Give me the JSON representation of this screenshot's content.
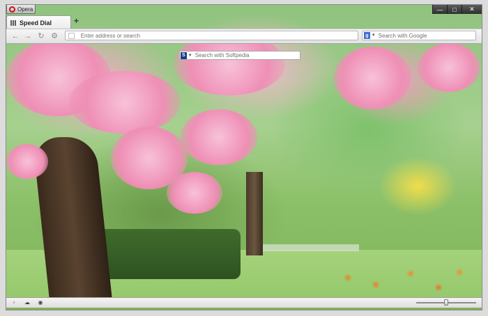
{
  "titlebar": {
    "app_label": "Opera"
  },
  "tabs": [
    {
      "label": "Speed Dial"
    }
  ],
  "toolbar": {
    "address_placeholder": "Enter address or search",
    "search_placeholder": "Search with Google",
    "search_engine_icon": "google-icon"
  },
  "speed_dial": {
    "search_placeholder": "Search with Softpedia",
    "search_engine_icon": "softpedia-icon"
  },
  "statusbar": {
    "zoom_level": 0.5
  },
  "colors": {
    "opera_red": "#cc0f16",
    "blossom_pink": "#ef8fb6",
    "foliage_green": "#7ec16b"
  }
}
